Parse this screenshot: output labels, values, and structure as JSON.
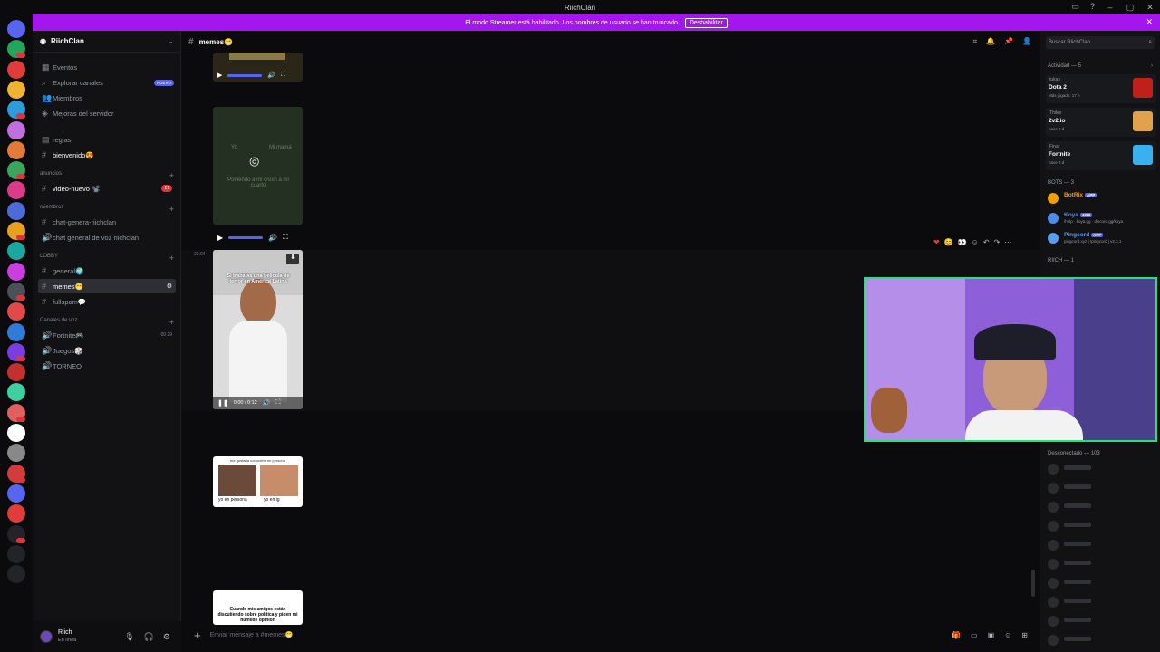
{
  "window": {
    "title": "RiichClan"
  },
  "banner": {
    "text": "El modo Streamer está habilitado. Los nombres de usuario se han truncado.",
    "button": "Deshabilitar"
  },
  "server": {
    "name": "RiichClan"
  },
  "sidebar": {
    "top_items": [
      "Eventos",
      "Explorar canales",
      "Miembros",
      "Mejoras del servidor"
    ],
    "new_badge": "NUEVO",
    "channels": [
      {
        "label": "reglas"
      },
      {
        "label": "bienvenido😍"
      },
      {
        "label": "video-nuevo 📽️",
        "badge": "21"
      },
      {
        "label": "chat-genera-riichclan"
      },
      {
        "label": "chat general de voz riichclan"
      },
      {
        "label": "general🌍"
      },
      {
        "label": "memes😁"
      },
      {
        "label": "fullspam💬"
      },
      {
        "label": "Fortnite🎮",
        "count": "00 29"
      },
      {
        "label": "Juegos🎲"
      },
      {
        "label": "TORNEO"
      }
    ],
    "categories": [
      "anuncios",
      "miembros",
      "LOBBY",
      "Canales de voz"
    ]
  },
  "user": {
    "name": "Riich",
    "status": "En línea"
  },
  "channel_header": {
    "name": "memes😁",
    "search_placeholder": "Buscar RiichClan"
  },
  "messages": {
    "timestamp": "23:04",
    "video_time": "0:00 / 0:12",
    "video_caption": "Si trabajas una película de terror en América Latina",
    "meme_caption": "Cuando mis amigos están discutiendo sobre política y piden mi humilde opinión",
    "meme2_top": "me gustaría conocerte en persona",
    "meme2_left": "yo en persona",
    "meme2_right": "yo en ig",
    "small_video_top": "Yo",
    "small_video_right": "Mi mamá",
    "small_video_caption": "Poniendo a mi crush a mi cuarto"
  },
  "composer": {
    "placeholder": "Enviar mensaje a #memes😁"
  },
  "members": {
    "activity_header": "Actividad — 5",
    "activities": [
      {
        "who": "tukas",
        "game": "Dota 2",
        "since": "Más jugado: 17 h",
        "color": "#c0201a"
      },
      {
        "who": "Thilex",
        "game": "2v2.io",
        "since": "hace 2 d",
        "color": "#e0a24a"
      },
      {
        "who": "Final",
        "game": "Fortnite",
        "since": "hace 3 d",
        "color": "#3ab0f0"
      }
    ],
    "bots_header": "BOTS — 3",
    "bots": [
      {
        "name": "BotRix",
        "status": "",
        "color": "#f0a000"
      },
      {
        "name": "Koya",
        "status": "/help · koya.gg · discord.gg/koya",
        "color": "#4c8de8"
      },
      {
        "name": "Pingcord",
        "status": "pingcord.xyz | !pingcord | v2.2.1",
        "color": "#5b9bf0"
      }
    ],
    "app_tag": "APP",
    "riich_header": "RIICH — 1",
    "offline_header": "Desconectado — 103"
  },
  "colors": {
    "accent": "#5865f2",
    "banner": "#a316ee",
    "webcam_border": "#23e27a"
  }
}
